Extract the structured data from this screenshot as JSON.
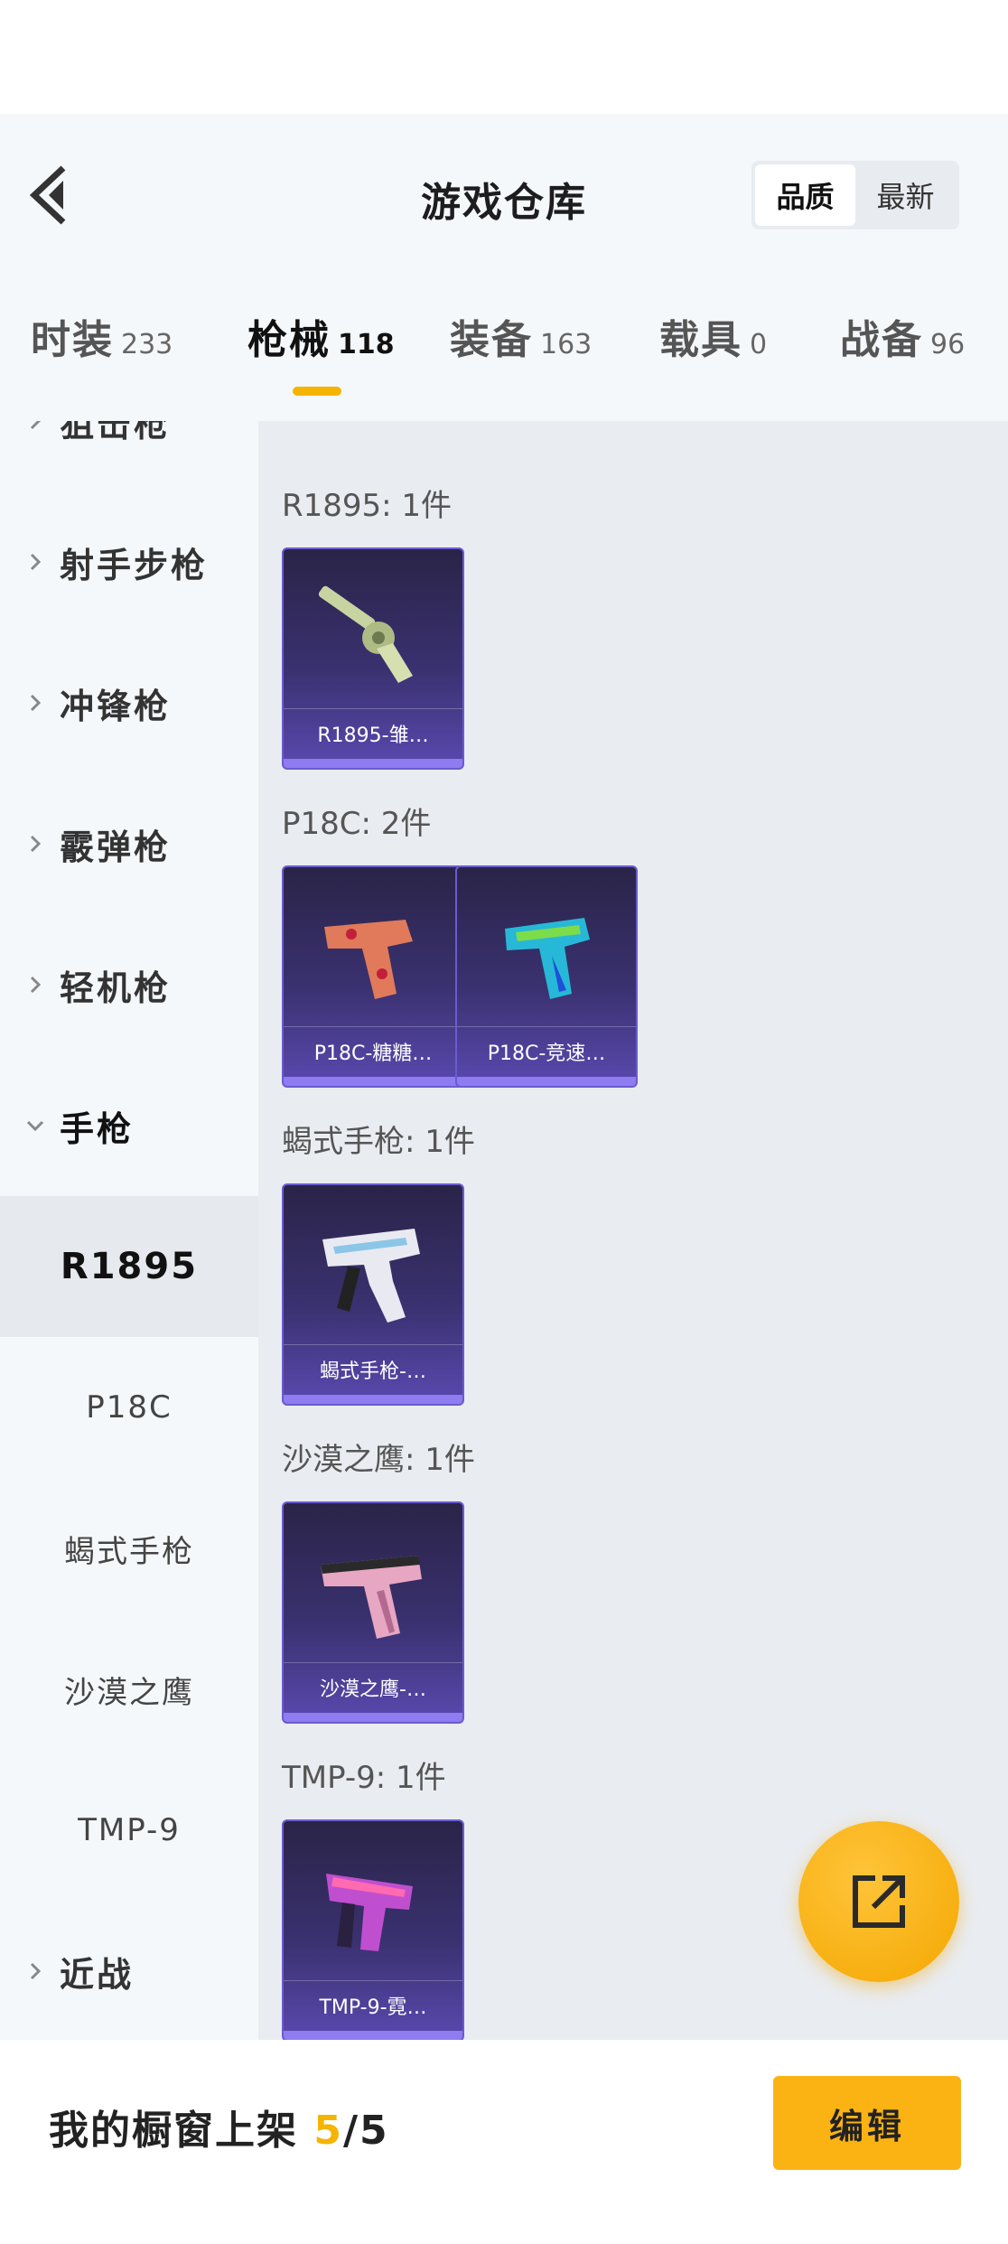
{
  "header": {
    "title": "游戏仓库",
    "sort_options": [
      "品质",
      "最新"
    ],
    "active_sort": "品质"
  },
  "tabs": [
    {
      "label": "时装",
      "count": "233"
    },
    {
      "label": "枪械",
      "count": "118"
    },
    {
      "label": "装备",
      "count": "163"
    },
    {
      "label": "载具",
      "count": "0"
    },
    {
      "label": "战备",
      "count": "96"
    }
  ],
  "active_tab": "枪械",
  "sidebar": {
    "categories": [
      {
        "label": "狙击枪",
        "expanded": false
      },
      {
        "label": "射手步枪",
        "expanded": false
      },
      {
        "label": "冲锋枪",
        "expanded": false
      },
      {
        "label": "霰弹枪",
        "expanded": false
      },
      {
        "label": "轻机枪",
        "expanded": false
      },
      {
        "label": "手枪",
        "expanded": true
      },
      {
        "label": "近战",
        "expanded": false
      }
    ],
    "sub_items": [
      "R1895",
      "P18C",
      "蝎式手枪",
      "沙漠之鹰",
      "TMP-9"
    ],
    "selected_sub": "R1895"
  },
  "groups": [
    {
      "title": "R1895: 1件",
      "items": [
        {
          "name": "R1895-雏…",
          "icon": "revolver-icon"
        }
      ]
    },
    {
      "title": "P18C: 2件",
      "items": [
        {
          "name": "P18C-糖糖…",
          "icon": "pistol-red-icon"
        },
        {
          "name": "P18C-竞速…",
          "icon": "pistol-blue-icon"
        }
      ]
    },
    {
      "title": "蝎式手枪: 1件",
      "items": [
        {
          "name": "蝎式手枪-…",
          "icon": "scorpion-icon"
        }
      ]
    },
    {
      "title": "沙漠之鹰: 1件",
      "items": [
        {
          "name": "沙漠之鹰-…",
          "icon": "deagle-icon"
        }
      ]
    },
    {
      "title": "TMP-9: 1件",
      "items": [
        {
          "name": "TMP-9-霓…",
          "icon": "smg-icon"
        }
      ]
    }
  ],
  "bottom": {
    "showcase_label": "我的橱窗上架",
    "showcase_current": "5",
    "showcase_total": "/5",
    "edit_label": "编辑"
  },
  "colors": {
    "accent": "#f5b400",
    "card_bg": "#3a3170",
    "card_border": "#6a5bd0"
  }
}
